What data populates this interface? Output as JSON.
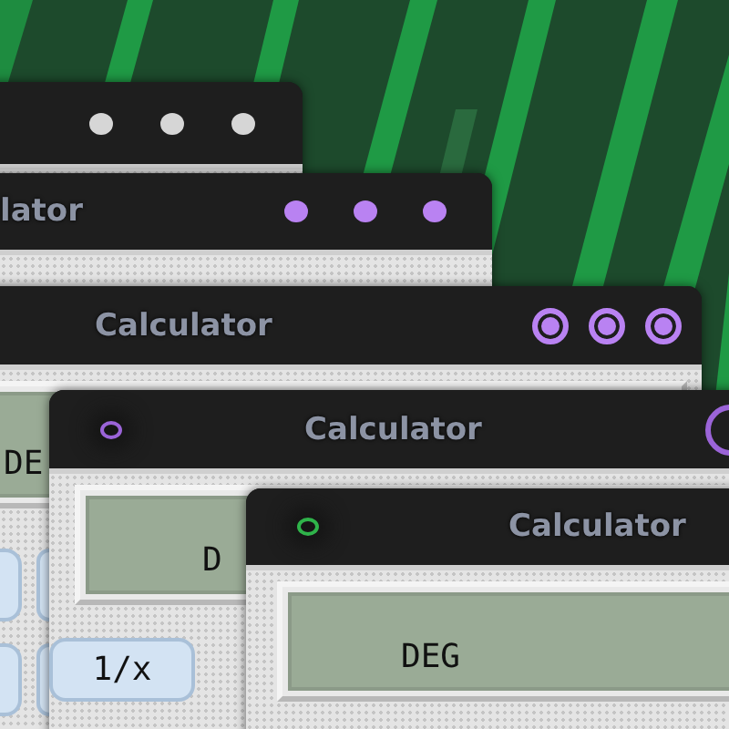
{
  "windows": [
    {
      "controls": [
        {
          "kind": "dot",
          "color": "#d6d6d6"
        },
        {
          "kind": "dot",
          "color": "#d6d6d6"
        },
        {
          "kind": "dot",
          "color": "#d6d6d6"
        }
      ]
    },
    {
      "title": "lator",
      "controls": [
        {
          "kind": "dot",
          "color": "#b982f2"
        },
        {
          "kind": "dot",
          "color": "#b982f2"
        },
        {
          "kind": "dot",
          "color": "#b982f2"
        }
      ]
    },
    {
      "title": "Calculator",
      "controls": [
        {
          "kind": "ring",
          "color": "#b982f2"
        },
        {
          "kind": "ring",
          "color": "#b982f2"
        },
        {
          "kind": "ring",
          "color": "#b982f2"
        }
      ],
      "display": "DE",
      "keys": [
        {
          "kind": "blank"
        },
        {
          "kind": "blank"
        },
        {
          "kind": "blank"
        },
        {
          "kind": "blank"
        }
      ]
    },
    {
      "title": "Calculator",
      "menu_ring": {
        "color": "#9b64d8"
      },
      "controls": [
        {
          "kind": "big-ring",
          "color": "#9b64d8"
        }
      ],
      "display": "D",
      "keys": [
        {
          "kind": "label",
          "label": "1/x"
        }
      ]
    },
    {
      "title": "Calculator",
      "menu_ring": {
        "color": "#2fb34a"
      },
      "display": "DEG"
    }
  ]
}
